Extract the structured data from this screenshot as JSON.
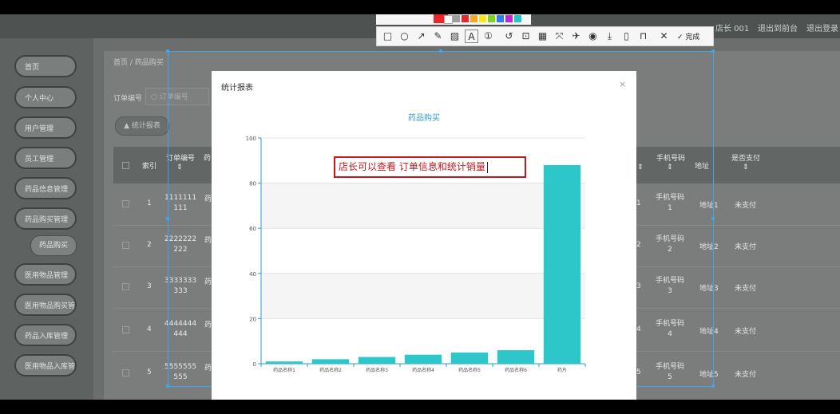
{
  "header": {
    "user": "店长 001",
    "back_label": "退出到前台",
    "logout_label": "退出登录"
  },
  "sidebar": {
    "items": [
      {
        "label": "首页"
      },
      {
        "label": "个人中心"
      },
      {
        "label": "用户管理"
      },
      {
        "label": "员工管理"
      },
      {
        "label": "药品信息管理"
      },
      {
        "label": "药品购买管理"
      },
      {
        "label": "药品购买"
      },
      {
        "label": "医用物品管理"
      },
      {
        "label": "医用物品购买管理"
      },
      {
        "label": "药品入库管理"
      },
      {
        "label": "医用物品入库管理"
      }
    ]
  },
  "breadcrumb": {
    "home": "首页",
    "current": "药品购买"
  },
  "search": {
    "label": "订单编号",
    "placeholder": "订单编号"
  },
  "report_button": "统计报表",
  "table": {
    "headers": {
      "index": "索引",
      "order_no": "订单编号",
      "drug": "药",
      "phone": "手机号码",
      "address": "地址",
      "paid": "是否支付"
    },
    "rows": [
      {
        "index": "1",
        "order_line1": "1111111",
        "order_line2": "111",
        "drug": "药",
        "mid": "1",
        "phone_line1": "手机号码",
        "phone_line2": "1",
        "address": "地址1",
        "paid": "未支付"
      },
      {
        "index": "2",
        "order_line1": "2222222",
        "order_line2": "222",
        "drug": "药",
        "mid": "2",
        "phone_line1": "手机号码",
        "phone_line2": "2",
        "address": "地址2",
        "paid": "未支付"
      },
      {
        "index": "3",
        "order_line1": "3333333",
        "order_line2": "333",
        "drug": "药",
        "mid": "3",
        "phone_line1": "手机号码",
        "phone_line2": "3",
        "address": "地址3",
        "paid": "未支付"
      },
      {
        "index": "4",
        "order_line1": "4444444",
        "order_line2": "444",
        "drug": "药",
        "mid": "4",
        "phone_line1": "手机号码",
        "phone_line2": "4",
        "address": "地址4",
        "paid": "未支付"
      },
      {
        "index": "5",
        "order_line1": "5555555",
        "order_line2": "555",
        "drug": "药",
        "mid": "5",
        "phone_line1": "手机号码",
        "phone_line2": "5",
        "address": "地址5",
        "paid": "未支付"
      }
    ]
  },
  "modal": {
    "title": "统计报表",
    "close": "×"
  },
  "annotation": {
    "text": "店长可以查看 订单信息和统计销量"
  },
  "capture_toolbar": {
    "done_label": "完成",
    "palette": [
      "#e8262b",
      "#ffffff",
      "#9c9c9c",
      "#e8262b",
      "#f5a623",
      "#f8e71c",
      "#7ed321",
      "#2f7ded",
      "#c226d8",
      "#23c6c6"
    ]
  },
  "colors": {
    "bar": "#2ec7c9",
    "title": "#2e9dc7",
    "annotation": "#c4181e",
    "selection": "#3ea6e8"
  },
  "chart_data": {
    "type": "bar",
    "title": "药品购买",
    "categories": [
      "药品名称1",
      "药品名称2",
      "药品名称3",
      "药品名称4",
      "药品名称5",
      "药品名称6",
      "药片"
    ],
    "values": [
      1,
      2,
      3,
      4,
      5,
      6,
      88
    ],
    "ylim": [
      0,
      100
    ],
    "yticks": [
      0,
      20,
      40,
      60,
      80,
      100
    ],
    "xlabel": "",
    "ylabel": "",
    "grid": true,
    "color": "#2ec7c9"
  }
}
